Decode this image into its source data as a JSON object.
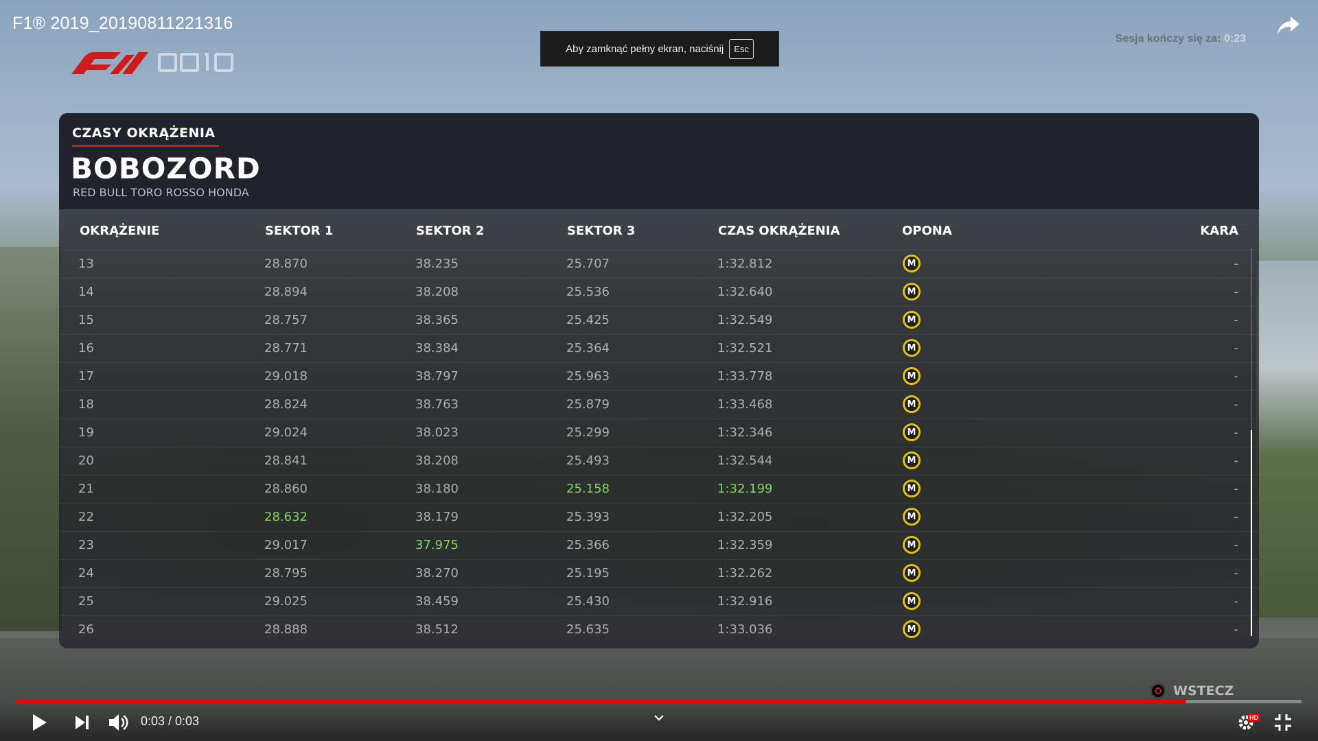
{
  "video": {
    "title": "F1® 2019_20190811221316",
    "fullscreen_hint": "Aby zamknąć pełny ekran, naciśnij",
    "fullscreen_key": "Esc",
    "time": "0:03 / 0:03",
    "progress_percent": 91
  },
  "game": {
    "session_label": "Sesja kończy się za:",
    "session_time": "0:23",
    "panel_title": "CZASY OKRĄŻENIA",
    "driver": "BOBOZORD",
    "team": "RED BULL TORO ROSSO HONDA",
    "columns": {
      "lap": "OKRĄŻENIE",
      "s1": "SEKTOR 1",
      "s2": "SEKTOR 2",
      "s3": "SEKTOR 3",
      "lap_time": "CZAS OKRĄŻENIA",
      "tyre": "OPONA",
      "penalty": "KARA"
    },
    "laps": [
      {
        "lap": "13",
        "s1": "28.870",
        "s2": "38.235",
        "s3": "25.707",
        "lap_time": "1:32.812",
        "tyre": "M",
        "penalty": "-"
      },
      {
        "lap": "14",
        "s1": "28.894",
        "s2": "38.208",
        "s3": "25.536",
        "lap_time": "1:32.640",
        "tyre": "M",
        "penalty": "-"
      },
      {
        "lap": "15",
        "s1": "28.757",
        "s2": "38.365",
        "s3": "25.425",
        "lap_time": "1:32.549",
        "tyre": "M",
        "penalty": "-"
      },
      {
        "lap": "16",
        "s1": "28.771",
        "s2": "38.384",
        "s3": "25.364",
        "lap_time": "1:32.521",
        "tyre": "M",
        "penalty": "-"
      },
      {
        "lap": "17",
        "s1": "29.018",
        "s2": "38.797",
        "s3": "25.963",
        "lap_time": "1:33.778",
        "tyre": "M",
        "penalty": "-"
      },
      {
        "lap": "18",
        "s1": "28.824",
        "s2": "38.763",
        "s3": "25.879",
        "lap_time": "1:33.468",
        "tyre": "M",
        "penalty": "-"
      },
      {
        "lap": "19",
        "s1": "29.024",
        "s2": "38.023",
        "s3": "25.299",
        "lap_time": "1:32.346",
        "tyre": "M",
        "penalty": "-"
      },
      {
        "lap": "20",
        "s1": "28.841",
        "s2": "38.208",
        "s3": "25.493",
        "lap_time": "1:32.544",
        "tyre": "M",
        "penalty": "-"
      },
      {
        "lap": "21",
        "s1": "28.860",
        "s2": "38.180",
        "s3": "25.158",
        "lap_time": "1:32.199",
        "tyre": "M",
        "penalty": "-",
        "best": [
          "s3",
          "lap_time"
        ]
      },
      {
        "lap": "22",
        "s1": "28.632",
        "s2": "38.179",
        "s3": "25.393",
        "lap_time": "1:32.205",
        "tyre": "M",
        "penalty": "-",
        "best": [
          "s1"
        ]
      },
      {
        "lap": "23",
        "s1": "29.017",
        "s2": "37.975",
        "s3": "25.366",
        "lap_time": "1:32.359",
        "tyre": "M",
        "penalty": "-",
        "best": [
          "s2"
        ]
      },
      {
        "lap": "24",
        "s1": "28.795",
        "s2": "38.270",
        "s3": "25.195",
        "lap_time": "1:32.262",
        "tyre": "M",
        "penalty": "-"
      },
      {
        "lap": "25",
        "s1": "29.025",
        "s2": "38.459",
        "s3": "25.430",
        "lap_time": "1:32.916",
        "tyre": "M",
        "penalty": "-"
      },
      {
        "lap": "26",
        "s1": "28.888",
        "s2": "38.512",
        "s3": "25.635",
        "lap_time": "1:33.036",
        "tyre": "M",
        "penalty": "-"
      }
    ],
    "back_label": "WSTECZ",
    "tyre_color": "#e4c20a",
    "best_color": "#7fd65d"
  },
  "controls": {
    "hd_badge": "HD",
    "icons": [
      "play-icon",
      "next-icon",
      "volume-icon",
      "chevron-down-icon",
      "settings-icon",
      "exit-fullscreen-icon",
      "share-icon"
    ]
  }
}
